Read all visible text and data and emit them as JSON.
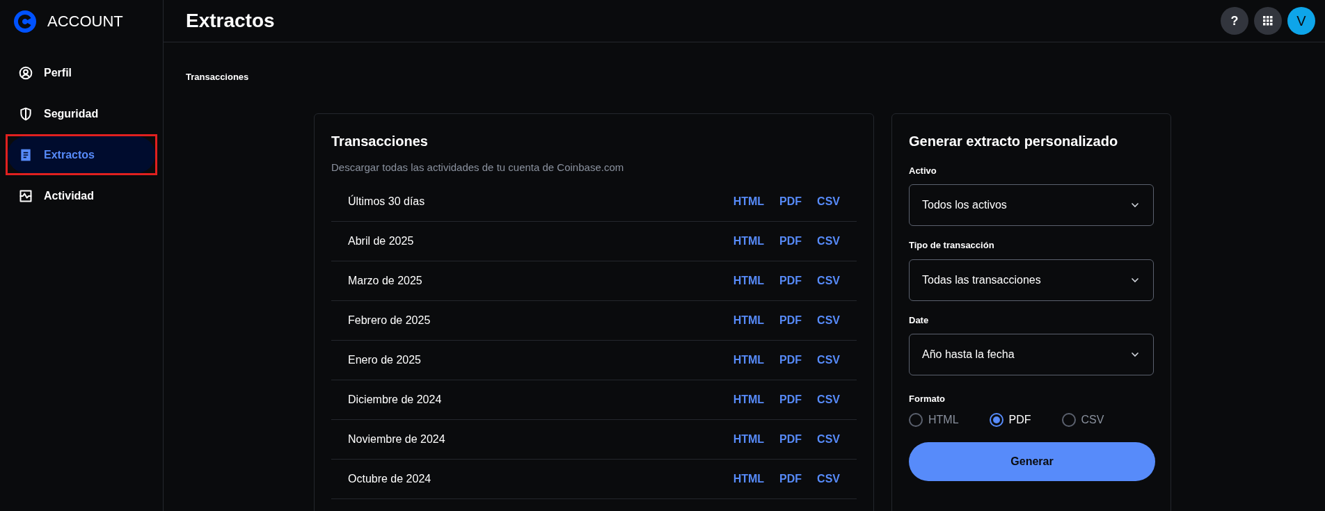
{
  "sidebar": {
    "brand": "ACCOUNT",
    "items": [
      {
        "label": "Perfil",
        "kind": "user",
        "selected": false
      },
      {
        "label": "Seguridad",
        "kind": "shield",
        "selected": false
      },
      {
        "label": "Extractos",
        "kind": "document",
        "selected": true
      },
      {
        "label": "Actividad",
        "kind": "activity",
        "selected": false
      }
    ]
  },
  "header": {
    "title": "Extractos",
    "help": "?",
    "avatar": "V"
  },
  "section_label": "Transacciones",
  "transactions": {
    "title": "Transacciones",
    "subtitle": "Descargar todas las actividades de tu cuenta de Coinbase.com",
    "rows": [
      {
        "period": "Últimos 30 días",
        "links": [
          "HTML",
          "PDF",
          "CSV"
        ]
      },
      {
        "period": "Abril de 2025",
        "links": [
          "HTML",
          "PDF",
          "CSV"
        ]
      },
      {
        "period": "Marzo de 2025",
        "links": [
          "HTML",
          "PDF",
          "CSV"
        ]
      },
      {
        "period": "Febrero de 2025",
        "links": [
          "HTML",
          "PDF",
          "CSV"
        ]
      },
      {
        "period": "Enero de 2025",
        "links": [
          "HTML",
          "PDF",
          "CSV"
        ]
      },
      {
        "period": "Diciembre de 2024",
        "links": [
          "HTML",
          "PDF",
          "CSV"
        ]
      },
      {
        "period": "Noviembre de 2024",
        "links": [
          "HTML",
          "PDF",
          "CSV"
        ]
      },
      {
        "period": "Octubre de 2024",
        "links": [
          "HTML",
          "PDF",
          "CSV"
        ]
      }
    ]
  },
  "custom_statement": {
    "title": "Generar extracto personalizado",
    "selects": [
      {
        "label": "Activo",
        "value": "Todos los activos"
      },
      {
        "label": "Tipo de transacción",
        "value": "Todas las transacciones"
      },
      {
        "label": "Date",
        "value": "Año hasta la fecha"
      }
    ],
    "format": {
      "label": "Formato",
      "options": [
        {
          "label": "HTML",
          "selected": false
        },
        {
          "label": "PDF",
          "selected": true
        },
        {
          "label": "CSV",
          "selected": false
        }
      ]
    },
    "button": "Generar"
  }
}
